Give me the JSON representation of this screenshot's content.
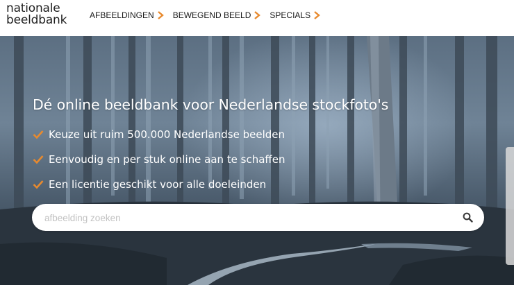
{
  "logo": {
    "line1": "nationale",
    "line2": "beeldbank"
  },
  "nav": [
    {
      "label": "AFBEELDINGEN"
    },
    {
      "label": "BEWEGEND BEELD"
    },
    {
      "label": "SPECIALS"
    }
  ],
  "hero": {
    "headline": "Dé online beeldbank voor Nederlandse stockfoto's",
    "bullets": [
      "Keuze uit ruim 500.000 Nederlandse beelden",
      "Eenvoudig en per stuk online aan te schaffen",
      "Een licentie geschikt voor alle doeleinden"
    ]
  },
  "search": {
    "placeholder": "afbeelding zoeken",
    "icon": "search-icon"
  },
  "colors": {
    "accent": "#e88a2e",
    "text": "#1a1a1a"
  }
}
